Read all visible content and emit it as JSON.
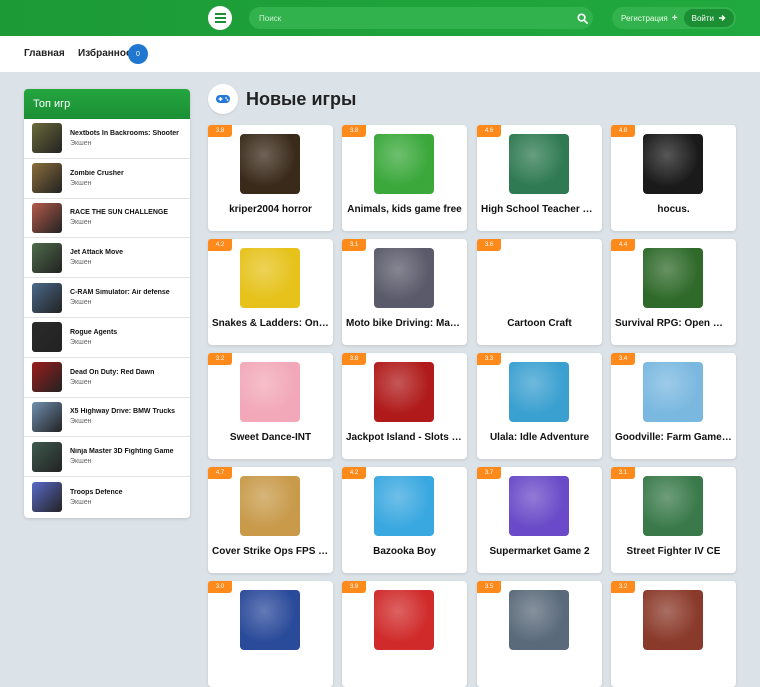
{
  "header": {
    "search_placeholder": "Поиск",
    "register_label": "Регистрация",
    "login_label": "Войти"
  },
  "nav": {
    "home": "Главная",
    "favorites": "Избранное",
    "favorites_count": "0"
  },
  "sidebar": {
    "title": "Топ игр",
    "items": [
      {
        "title": "Nextbots In Backrooms: Shooter",
        "category": "Экшен",
        "color": "#6b6a3a"
      },
      {
        "title": "Zombie Crusher",
        "category": "Экшен",
        "color": "#8a6d3b"
      },
      {
        "title": "RACE THE SUN CHALLENGE",
        "category": "Экшен",
        "color": "#b35a4a"
      },
      {
        "title": "Jet Attack Move",
        "category": "Экшен",
        "color": "#4f6b4a"
      },
      {
        "title": "C-RAM Simulator: Air defense",
        "category": "Экшен",
        "color": "#4a6a8a"
      },
      {
        "title": "Rogue Agents",
        "category": "Экшен",
        "color": "#2a2a2a"
      },
      {
        "title": "Dead On Duty: Red Dawn",
        "category": "Экшен",
        "color": "#9a1c1c"
      },
      {
        "title": "X5 Highway Drive: BMW Trucks",
        "category": "Экшен",
        "color": "#6f8fb0"
      },
      {
        "title": "Ninja Master 3D Fighting Game",
        "category": "Экшен",
        "color": "#3f5a4f"
      },
      {
        "title": "Troops Defence",
        "category": "Экшен",
        "color": "#5a6ac8"
      }
    ]
  },
  "main": {
    "title": "Новые игры",
    "games": [
      {
        "name": "kriper2004 horror",
        "rating": "3.8",
        "color": "#3a2a1a"
      },
      {
        "name": "Animals, kids game free",
        "rating": "3.8",
        "color": "#3aa83a"
      },
      {
        "name": "High School Teacher Life",
        "rating": "4.6",
        "color": "#2f7a52"
      },
      {
        "name": "hocus.",
        "rating": "4.8",
        "color": "#1a1a1a"
      },
      {
        "name": "Snakes & Ladders: Online",
        "rating": "4.2",
        "color": "#e6c21a"
      },
      {
        "name": "Moto bike Driving: Master",
        "rating": "3.1",
        "color": "#5a5a6a"
      },
      {
        "name": "Cartoon Craft",
        "rating": "3.6",
        "color": "#ffffff"
      },
      {
        "name": "Survival RPG: Open World",
        "rating": "4.4",
        "color": "#2f6a2a"
      },
      {
        "name": "Sweet Dance-INT",
        "rating": "3.2",
        "color": "#f2a8b8"
      },
      {
        "name": "Jackpot Island - Slots Machine",
        "rating": "3.8",
        "color": "#b01a1a"
      },
      {
        "name": "Ulala: Idle Adventure",
        "rating": "3.3",
        "color": "#3aa0d0"
      },
      {
        "name": "Goodville: Farm Game Adventure",
        "rating": "3.4",
        "color": "#7ab8e0"
      },
      {
        "name": "Cover Strike Ops FPS Shooter",
        "rating": "4.7",
        "color": "#c89a4a"
      },
      {
        "name": "Bazooka Boy",
        "rating": "4.2",
        "color": "#3aa8e0"
      },
      {
        "name": "Supermarket Game 2",
        "rating": "3.7",
        "color": "#6a4ac8"
      },
      {
        "name": "Street Fighter IV CE",
        "rating": "3.1",
        "color": "#3a7a4a"
      },
      {
        "name": "",
        "rating": "3.0",
        "color": "#2a4a9a"
      },
      {
        "name": "",
        "rating": "3.9",
        "color": "#d02a2a"
      },
      {
        "name": "",
        "rating": "3.5",
        "color": "#5a6a7a"
      },
      {
        "name": "",
        "rating": "3.2",
        "color": "#8a3a2a"
      }
    ]
  },
  "icons": {
    "menu": "menu-icon",
    "search": "search-icon",
    "register": "plus-icon",
    "login": "arrow-right-icon",
    "section": "gamepad-icon"
  },
  "colors": {
    "brand_green": "#1c9a36",
    "badge_blue": "#1f77d0",
    "rating_orange": "#ff8a1c"
  }
}
